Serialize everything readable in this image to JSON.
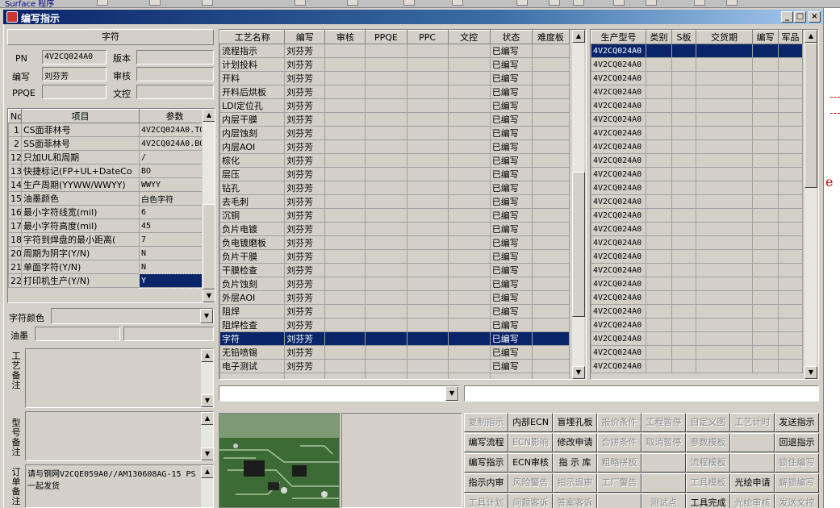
{
  "background_app": {
    "menu_text": "Surface  程序"
  },
  "window": {
    "title": "编写指示",
    "caption_buttons": [
      "_",
      "□",
      "×"
    ]
  },
  "left_panel": {
    "section_title": "字符",
    "pn_label": "PN",
    "pn_value": "4V2CQ024A0",
    "version_label": "版本",
    "version_value": "",
    "writer_label": "编写",
    "writer_value": "刘芬芳",
    "review_label": "审核",
    "review_value": "",
    "ppqe_label": "PPQE",
    "ppqe_value": "",
    "doc_ctrl_label": "文控",
    "doc_ctrl_value": "",
    "param_headers": [
      "No",
      "项目",
      "参数"
    ],
    "params": [
      {
        "no": "1",
        "item": "CS面菲林号",
        "value": "4V2CQ024A0.TO"
      },
      {
        "no": "2",
        "item": "SS面菲林号",
        "value": "4V2CQ024A0.BO"
      },
      {
        "no": "12",
        "item": "只加UL和周期",
        "value": "/"
      },
      {
        "no": "13",
        "item": "快捷标记(FP+UL+DateCo",
        "value": "BO"
      },
      {
        "no": "14",
        "item": "生产周期(YYWW/WWYY)",
        "value": "WWYY"
      },
      {
        "no": "15",
        "item": "油墨颜色",
        "value": "白色字符"
      },
      {
        "no": "16",
        "item": "最小字符线宽(mil)",
        "value": "6"
      },
      {
        "no": "17",
        "item": "最小字符高度(mil)",
        "value": "45"
      },
      {
        "no": "18",
        "item": "字符到焊盘的最小距离(",
        "value": "7"
      },
      {
        "no": "20",
        "item": "周期为阴字(Y/N)",
        "value": "N"
      },
      {
        "no": "21",
        "item": "单面字符(Y/N)",
        "value": "N"
      },
      {
        "no": "22",
        "item": "打印机生产(Y/N)",
        "value": "Y"
      }
    ],
    "char_color_label": "字符颜色",
    "ink_label": "油墨",
    "process_note_label": "工艺备注",
    "model_note_label": "型号备注",
    "order_note_label": "订单备注",
    "order_note_text": "请与钢网V2CQE059A0//AM130608AG-15 PS一起发货"
  },
  "process_grid": {
    "headers": [
      "工艺名称",
      "编写",
      "审核",
      "PPQE",
      "PPC",
      "文控",
      "状态",
      "难度板"
    ],
    "rows": [
      {
        "name": "流程指示",
        "writer": "刘芬芳",
        "status": "已编写"
      },
      {
        "name": "计划投料",
        "writer": "刘芬芳",
        "status": "已编写"
      },
      {
        "name": "开料",
        "writer": "刘芬芳",
        "status": "已编写"
      },
      {
        "name": "开料后烘板",
        "writer": "刘芬芳",
        "status": "已编写"
      },
      {
        "name": "LDI定位孔",
        "writer": "刘芬芳",
        "status": "已编写"
      },
      {
        "name": "内层干膜",
        "writer": "刘芬芳",
        "status": "已编写"
      },
      {
        "name": "内层蚀刻",
        "writer": "刘芬芳",
        "status": "已编写"
      },
      {
        "name": "内层AOI",
        "writer": "刘芬芳",
        "status": "已编写"
      },
      {
        "name": "棕化",
        "writer": "刘芬芳",
        "status": "已编写"
      },
      {
        "name": "层压",
        "writer": "刘芬芳",
        "status": "已编写"
      },
      {
        "name": "钻孔",
        "writer": "刘芬芳",
        "status": "已编写"
      },
      {
        "name": "去毛刺",
        "writer": "刘芬芳",
        "status": "已编写"
      },
      {
        "name": "沉铜",
        "writer": "刘芬芳",
        "status": "已编写"
      },
      {
        "name": "负片电镀",
        "writer": "刘芬芳",
        "status": "已编写"
      },
      {
        "name": "负电镀磨板",
        "writer": "刘芬芳",
        "status": "已编写"
      },
      {
        "name": "负片干膜",
        "writer": "刘芬芳",
        "status": "已编写"
      },
      {
        "name": "干膜检查",
        "writer": "刘芬芳",
        "status": "已编写"
      },
      {
        "name": "负片蚀刻",
        "writer": "刘芬芳",
        "status": "已编写"
      },
      {
        "name": "外层AOI",
        "writer": "刘芬芳",
        "status": "已编写"
      },
      {
        "name": "阻焊",
        "writer": "刘芬芳",
        "status": "已编写"
      },
      {
        "name": "阻焊检查",
        "writer": "刘芬芳",
        "status": "已编写"
      },
      {
        "name": "字符",
        "writer": "刘芬芳",
        "status": "已编写"
      },
      {
        "name": "无铅喷锡",
        "writer": "刘芬芳",
        "status": "已编写"
      },
      {
        "name": "电子测试",
        "writer": "刘芬芳",
        "status": "已编写"
      }
    ]
  },
  "model_grid": {
    "headers": [
      "生产型号",
      "类别",
      "S板",
      "交货期",
      "编写",
      "军品"
    ],
    "model": "4V2CQ024A0",
    "row_count": 24
  },
  "buttons": [
    [
      "复制指示",
      "内部ECN",
      "盲埋孔板",
      "报价条件",
      "工程暂停",
      "自定义图",
      "工艺计时",
      "发送指示"
    ],
    [
      "编写流程",
      "ECN影响",
      "修改申请",
      "合拼条件",
      "取消暂停",
      "参数模板",
      "",
      "回退指示"
    ],
    [
      "编写指示",
      "ECN审核",
      "指 示 库",
      "粗略拼板",
      "",
      "流程模板",
      "",
      "锁住编写"
    ],
    [
      "指示内审",
      "风险警告",
      "指示退审",
      "工厂警告",
      "",
      "工具模板",
      "光绘申请",
      "解锁编写"
    ],
    [
      "工具计划",
      "问题客诉",
      "答案客诉",
      "",
      "测试点",
      "工具完成",
      "光绘审核",
      "发送文控"
    ]
  ],
  "buttons_disabled": [
    [
      true,
      false,
      false,
      true,
      true,
      true,
      true,
      false
    ],
    [
      false,
      true,
      false,
      true,
      true,
      true,
      true,
      false
    ],
    [
      false,
      false,
      false,
      true,
      true,
      true,
      true,
      true
    ],
    [
      false,
      true,
      true,
      true,
      true,
      true,
      false,
      true
    ],
    [
      true,
      true,
      true,
      true,
      true,
      false,
      true,
      true
    ]
  ]
}
